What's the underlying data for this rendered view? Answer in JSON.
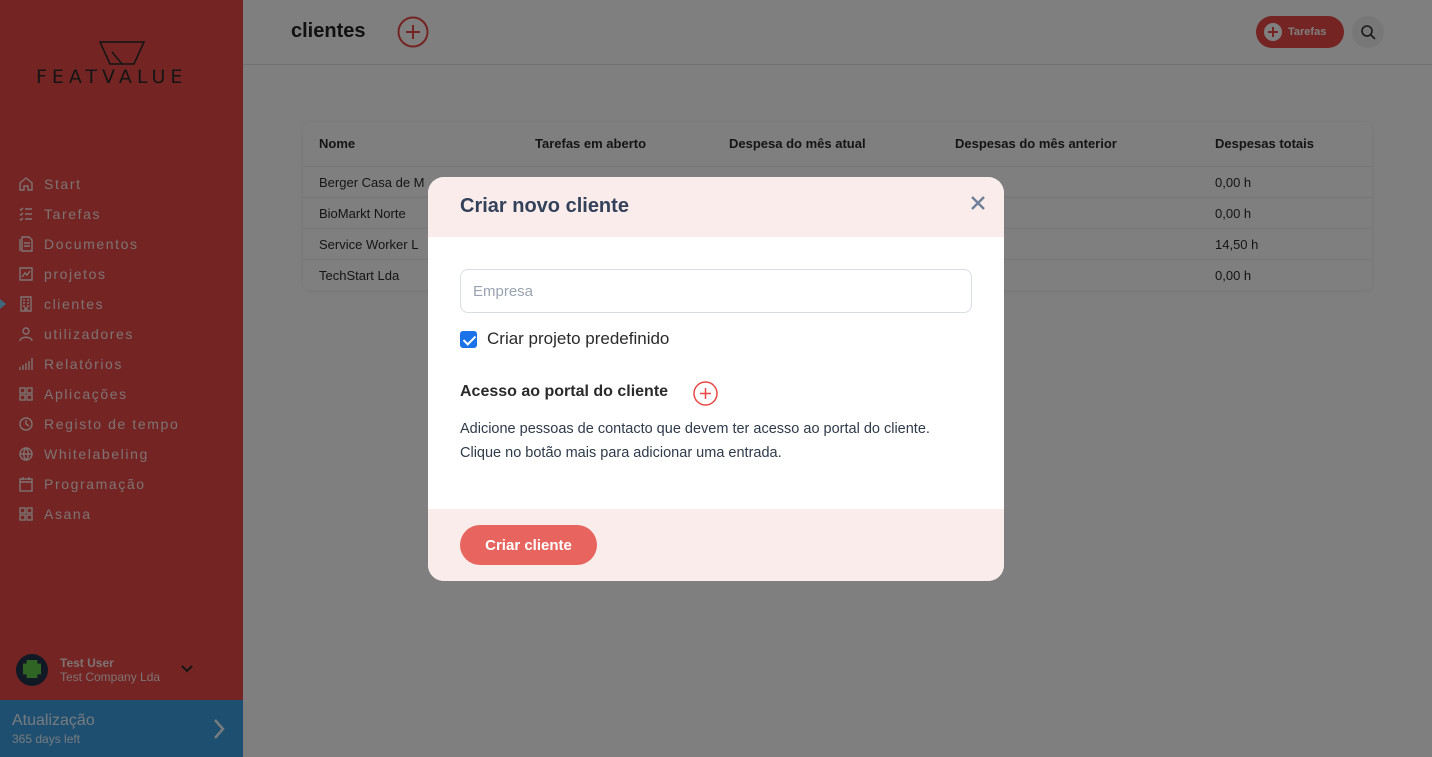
{
  "app": {
    "logo_text": "FEATVALUE",
    "accent_color": "#e84845",
    "link_color": "#3e9ee0"
  },
  "sidebar": {
    "items": [
      {
        "label": "Start",
        "icon": "home-icon"
      },
      {
        "label": "Tarefas",
        "icon": "task-list-icon"
      },
      {
        "label": "Documentos",
        "icon": "documents-icon"
      },
      {
        "label": "projetos",
        "icon": "projects-chart-icon"
      },
      {
        "label": "clientes",
        "icon": "building-icon",
        "active": true
      },
      {
        "label": "utilizadores",
        "icon": "user-icon"
      },
      {
        "label": "Relatórios",
        "icon": "report-bars-icon"
      },
      {
        "label": "Aplicações",
        "icon": "apps-grid-icon"
      },
      {
        "label": "Registo de tempo",
        "icon": "clock-icon"
      },
      {
        "label": "Whitelabeling",
        "icon": "globe-icon"
      },
      {
        "label": "Programação",
        "icon": "calendar-icon"
      },
      {
        "label": "Asana",
        "icon": "apps-grid-icon"
      }
    ],
    "user": {
      "name": "Test User",
      "company": "Test Company Lda"
    },
    "upgrade": {
      "title": "Atualização",
      "subtitle": "365 days left"
    }
  },
  "header": {
    "title": "clientes",
    "tasks_button": "Tarefas"
  },
  "table": {
    "columns": [
      "Nome",
      "Tarefas em aberto",
      "Despesa do mês atual",
      "Despesas do mês anterior",
      "Despesas totais"
    ],
    "rows": [
      {
        "name": "Berger Casa de M",
        "total": "0,00 h"
      },
      {
        "name": "BioMarkt Norte",
        "total": "0,00 h"
      },
      {
        "name": "Service Worker L",
        "total": "14,50 h"
      },
      {
        "name": "TechStart Lda",
        "total": "0,00 h"
      }
    ]
  },
  "modal": {
    "title": "Criar novo cliente",
    "company_placeholder": "Empresa",
    "company_value": "",
    "default_project_label": "Criar projeto predefinido",
    "default_project_checked": true,
    "portal_title": "Acesso ao portal do cliente",
    "portal_description": "Adicione pessoas de contacto que devem ter acesso ao portal do cliente. Clique no botão mais para adicionar uma entrada.",
    "submit_label": "Criar cliente"
  }
}
